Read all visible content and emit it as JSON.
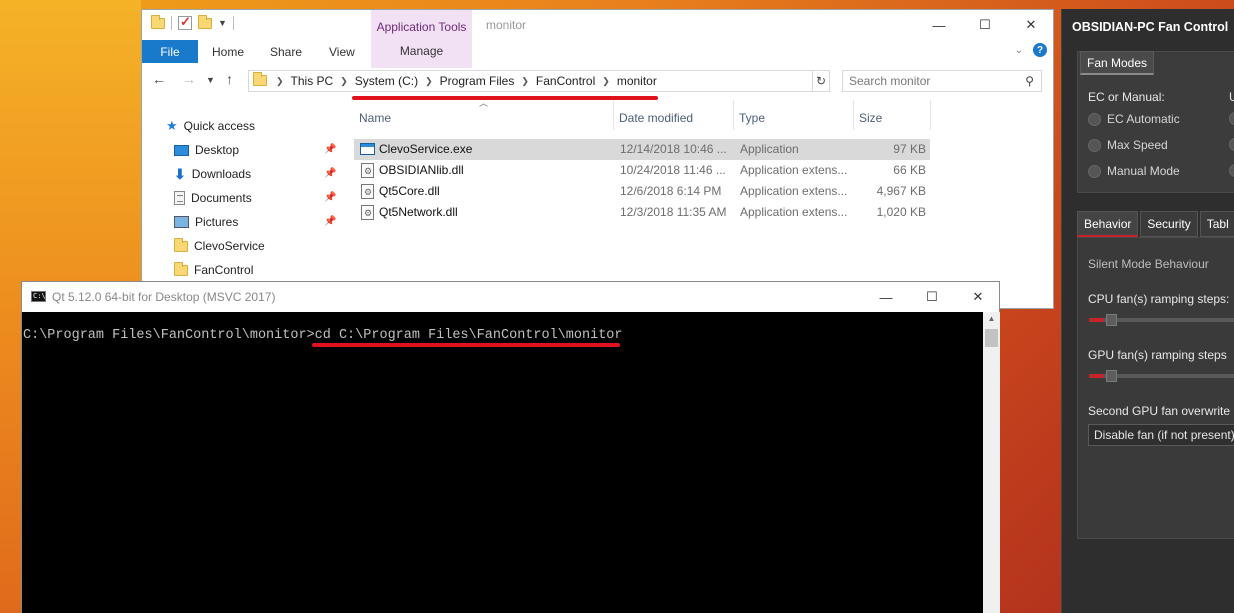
{
  "explorer": {
    "title": "monitor",
    "app_tools_label": "Application Tools",
    "manage_tab": "Manage",
    "ribbon_tabs": [
      "File",
      "Home",
      "Share",
      "View"
    ],
    "breadcrumb": [
      "This PC",
      "System (C:)",
      "Program Files",
      "FanControl",
      "monitor"
    ],
    "search_placeholder": "Search monitor",
    "nav_items": [
      {
        "label": "Quick access",
        "icon": "star-icon",
        "pinned": false
      },
      {
        "label": "Desktop",
        "icon": "desktop-folder-icon",
        "pinned": true
      },
      {
        "label": "Downloads",
        "icon": "download-arrow-icon",
        "pinned": true
      },
      {
        "label": "Documents",
        "icon": "document-icon",
        "pinned": true
      },
      {
        "label": "Pictures",
        "icon": "pictures-icon",
        "pinned": true
      },
      {
        "label": "ClevoService",
        "icon": "folder-icon",
        "pinned": false
      },
      {
        "label": "FanControl",
        "icon": "folder-icon",
        "pinned": false
      }
    ],
    "columns": [
      "Name",
      "Date modified",
      "Type",
      "Size"
    ],
    "files": [
      {
        "name": "ClevoService.exe",
        "date": "12/14/2018 10:46 ...",
        "type": "Application",
        "size": "97 KB",
        "icon": "exe-icon",
        "selected": true
      },
      {
        "name": "OBSIDIANlib.dll",
        "date": "10/24/2018 11:46 ...",
        "type": "Application extens...",
        "size": "66 KB",
        "icon": "dll-icon",
        "selected": false
      },
      {
        "name": "Qt5Core.dll",
        "date": "12/6/2018 6:14 PM",
        "type": "Application extens...",
        "size": "4,967 KB",
        "icon": "dll-icon",
        "selected": false
      },
      {
        "name": "Qt5Network.dll",
        "date": "12/3/2018 11:35 AM",
        "type": "Application extens...",
        "size": "1,020 KB",
        "icon": "dll-icon",
        "selected": false
      }
    ]
  },
  "console": {
    "title": "Qt 5.12.0 64-bit for Desktop (MSVC 2017)",
    "prompt": "C:\\Program Files\\FanControl\\monitor>",
    "command": "cd C:\\Program Files\\FanControl\\monitor"
  },
  "fan_control": {
    "title": "OBSIDIAN-PC Fan Control",
    "modes_tab": "Fan Modes",
    "ec_label": "EC or Manual:",
    "ec_label_right": "U",
    "modes": [
      "EC Automatic",
      "Max Speed",
      "Manual Mode"
    ],
    "tabs": [
      "Behavior",
      "Security",
      "Tabl"
    ],
    "silent_heading": "Silent Mode Behaviour",
    "cpu_label": "CPU fan(s) ramping steps:",
    "gpu_label": "GPU fan(s) ramping steps",
    "second_gpu_label": "Second GPU fan overwrite",
    "select_value": "Disable fan (if not present)",
    "cpu_slider_fraction": 0.1,
    "gpu_slider_fraction": 0.1,
    "accent": "#c8222b"
  },
  "annotation_color": "#e0111c"
}
